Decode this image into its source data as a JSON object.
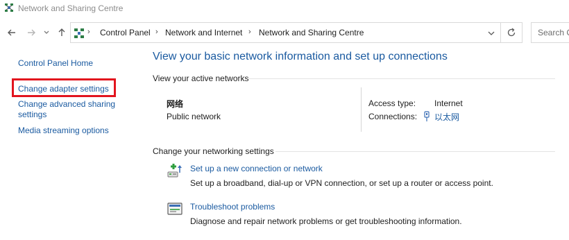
{
  "window": {
    "title": "Network and Sharing Centre",
    "icon": "network-globe-icon"
  },
  "nav": {
    "back_icon": "arrow-left-icon",
    "forward_icon": "arrow-right-icon",
    "recent_icon": "chevron-down-icon",
    "up_icon": "arrow-up-icon"
  },
  "breadcrumb": {
    "items": [
      "Control Panel",
      "Network and Internet",
      "Network and Sharing Centre"
    ],
    "separator": "›"
  },
  "search": {
    "placeholder": "Search C"
  },
  "sidebar": {
    "items": [
      {
        "label": "Control Panel Home"
      },
      {
        "label": "Change adapter settings",
        "highlighted": true
      },
      {
        "label": "Change advanced sharing settings"
      },
      {
        "label": "Media streaming options"
      }
    ]
  },
  "main": {
    "title": "View your basic network information and set up connections",
    "active_networks_label": "View your active networks",
    "network": {
      "name": "网络",
      "type": "Public network",
      "access_type_label": "Access type:",
      "access_type_value": "Internet",
      "connections_label": "Connections:",
      "connection_name": "以太网",
      "connection_icon": "ethernet-plug-icon"
    },
    "settings_label": "Change your networking settings",
    "tasks": [
      {
        "icon": "new-connection-icon",
        "link": "Set up a new connection or network",
        "description": "Set up a broadband, dial-up or VPN connection, or set up a router or access point."
      },
      {
        "icon": "troubleshoot-icon",
        "link": "Troubleshoot problems",
        "description": "Diagnose and repair network problems or get troubleshooting information."
      }
    ]
  },
  "colors": {
    "link": "#1a5aa0",
    "highlight_border": "#e2141e",
    "title_gray": "#8c8c8c"
  }
}
